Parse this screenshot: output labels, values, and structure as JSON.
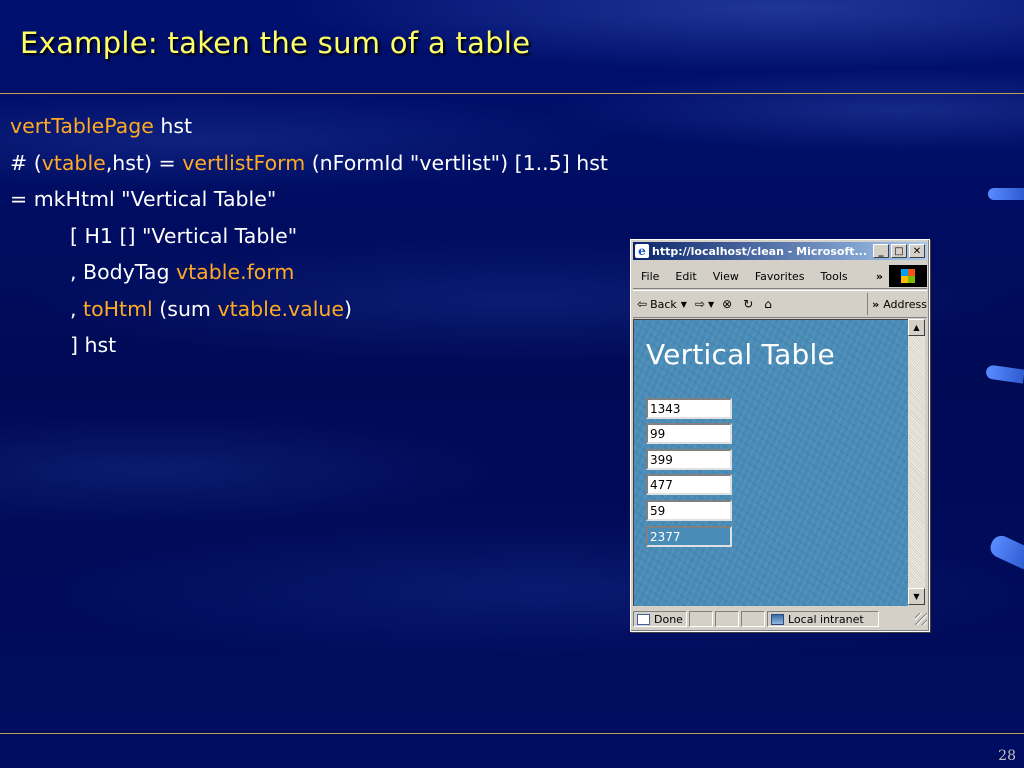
{
  "slide": {
    "title": "Example: taken the sum of a table",
    "page_number": "28",
    "colors": {
      "title": "#ffff66",
      "highlight": "#ffaa22",
      "text": "#ffffff",
      "background": "#000c5a"
    }
  },
  "code": {
    "line1": {
      "a": "vertTablePage",
      "b": " hst"
    },
    "line2": {
      "a": "# (",
      "b": "vtable",
      "c": ",hst) = ",
      "d": "vertlistForm",
      "e": " (nFormId \"vertlist\") [1..5] hst"
    },
    "line3": {
      "a": "= mkHtml \"Vertical Table\""
    },
    "line4": {
      "a": "[ H1 [] \"Vertical Table\""
    },
    "line5": {
      "a": ", BodyTag ",
      "b": "vtable.form"
    },
    "line6": {
      "a": ", ",
      "b": "toHtml",
      "c": " (sum ",
      "d": "vtable.value",
      "e": ")"
    },
    "line7": {
      "a": "] hst"
    }
  },
  "browser": {
    "title": "http://localhost/clean - Microsoft...",
    "menu": [
      "File",
      "Edit",
      "View",
      "Favorites",
      "Tools"
    ],
    "toolbar": {
      "back": "Back",
      "address": "Address"
    },
    "heading": "Vertical Table",
    "inputs": [
      "1343",
      "99",
      "399",
      "477",
      "59"
    ],
    "sum": "2377",
    "status": {
      "done": "Done",
      "zone": "Local intranet"
    }
  }
}
